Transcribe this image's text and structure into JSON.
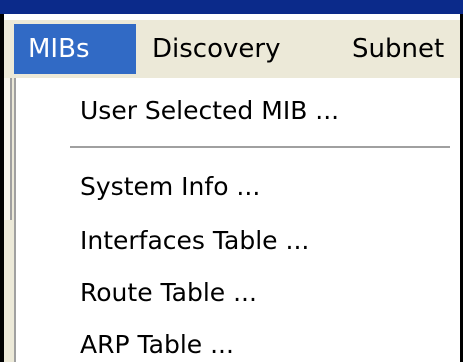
{
  "menubar": {
    "items": [
      {
        "label": "MIBs",
        "active": true
      },
      {
        "label": "Discovery",
        "active": false
      },
      {
        "label": "Subnet",
        "active": false
      }
    ]
  },
  "dropdown": {
    "items": [
      {
        "label": "User Selected MIB ..."
      },
      {
        "label": "System Info ..."
      },
      {
        "label": "Interfaces Table ..."
      },
      {
        "label": "Route Table ..."
      },
      {
        "label": "ARP Table ..."
      }
    ]
  },
  "colors": {
    "highlight": "#316ac5",
    "menubar_bg": "#ece9d8",
    "menu_bg": "#ffffff",
    "titlebar": "#0b2a8a"
  }
}
